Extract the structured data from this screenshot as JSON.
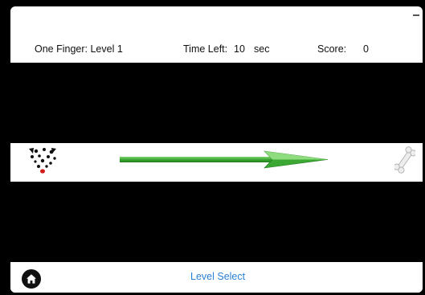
{
  "header": {
    "mode_label": "One Finger: Level 1",
    "time_label": "Time Left:",
    "time_value": "10",
    "time_unit": "sec",
    "score_label": "Score:",
    "score_value": "0"
  },
  "game": {
    "player_icon": "dalmatian-dog-icon",
    "direction_icon": "green-arrow-icon",
    "goal_icon": "bone-icon",
    "arrow_color": "#3aa832",
    "lane_color": "#ffffff",
    "wall_color": "#000000"
  },
  "footer": {
    "home_icon": "home-icon",
    "level_select_label": "Level Select",
    "link_color": "#2a7fd6"
  }
}
